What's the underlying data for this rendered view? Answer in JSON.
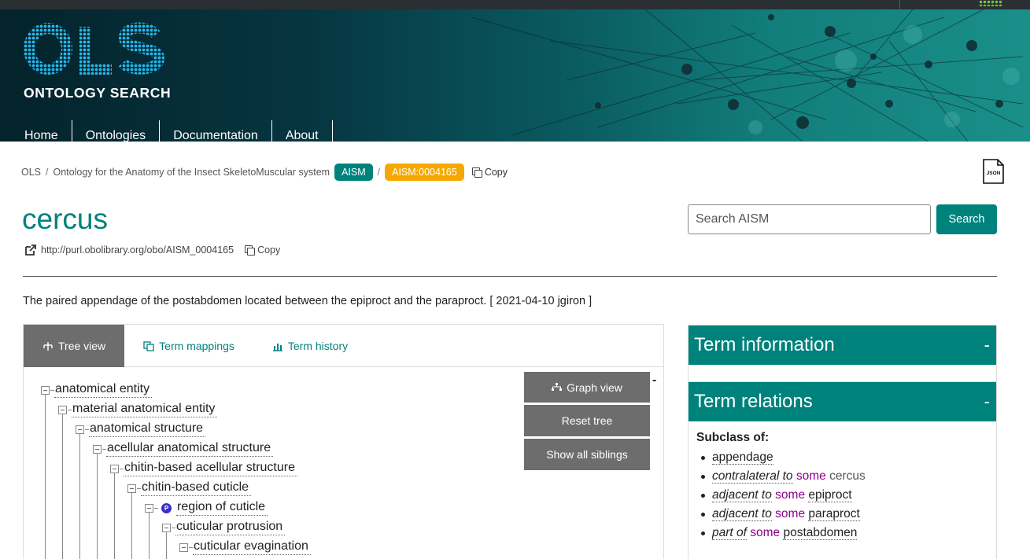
{
  "header": {
    "logo_text": "ONTOLOGY SEARCH",
    "logo_letters": "OLS",
    "nav": [
      {
        "label": "Home"
      },
      {
        "label": "Ontologies"
      },
      {
        "label": "Documentation"
      },
      {
        "label": "About"
      }
    ]
  },
  "breadcrumb": {
    "root": "OLS",
    "ontology_name": "Ontology for the Anatomy of the Insect SkeletoMuscular system",
    "ontology_badge": "AISM",
    "term_badge": "AISM:0004165",
    "copy_label": "Copy",
    "json_label": "JSON"
  },
  "term": {
    "title": "cercus",
    "iri": "http://purl.obolibrary.org/obo/AISM_0004165",
    "copy_label": "Copy",
    "definition": "The paired appendage of the postabdomen located between the epiproct and the paraproct. [ 2021-04-10 jgiron ]"
  },
  "search": {
    "placeholder": "Search AISM",
    "button_label": "Search"
  },
  "tabs": [
    {
      "label": "Tree view",
      "active": true
    },
    {
      "label": "Term mappings",
      "active": false
    },
    {
      "label": "Term history",
      "active": false
    }
  ],
  "tree": [
    {
      "label": "anatomical entity",
      "depth": 0
    },
    {
      "label": "material anatomical entity",
      "depth": 1
    },
    {
      "label": "anatomical structure",
      "depth": 2
    },
    {
      "label": "acellular anatomical structure",
      "depth": 3
    },
    {
      "label": "chitin-based acellular structure",
      "depth": 4
    },
    {
      "label": "chitin-based cuticle",
      "depth": 5
    },
    {
      "label": "region of cuticle",
      "depth": 6,
      "badge": "P"
    },
    {
      "label": "cuticular protrusion",
      "depth": 7
    },
    {
      "label": "cuticular evagination",
      "depth": 8
    }
  ],
  "tree_buttons": {
    "graph_view": "Graph view",
    "reset_tree": "Reset tree",
    "show_siblings": "Show all siblings",
    "collapse": "-"
  },
  "right_panel": {
    "term_information": "Term information",
    "term_relations": "Term relations",
    "collapse": "-",
    "subclass_of_label": "Subclass of:",
    "relations": [
      {
        "target": "appendage"
      },
      {
        "property": "contralateral to",
        "keyword": "some",
        "target": "cercus",
        "self": true
      },
      {
        "property": "adjacent to",
        "keyword": "some",
        "target": "epiproct"
      },
      {
        "property": "adjacent to",
        "keyword": "some",
        "target": "paraproct"
      },
      {
        "property": "part of",
        "keyword": "some",
        "target": "postabdomen"
      }
    ]
  },
  "colors": {
    "teal": "#00827c",
    "amber": "#f6a800",
    "grey_button": "#6d6d6d",
    "keyword": "#8b008b"
  }
}
